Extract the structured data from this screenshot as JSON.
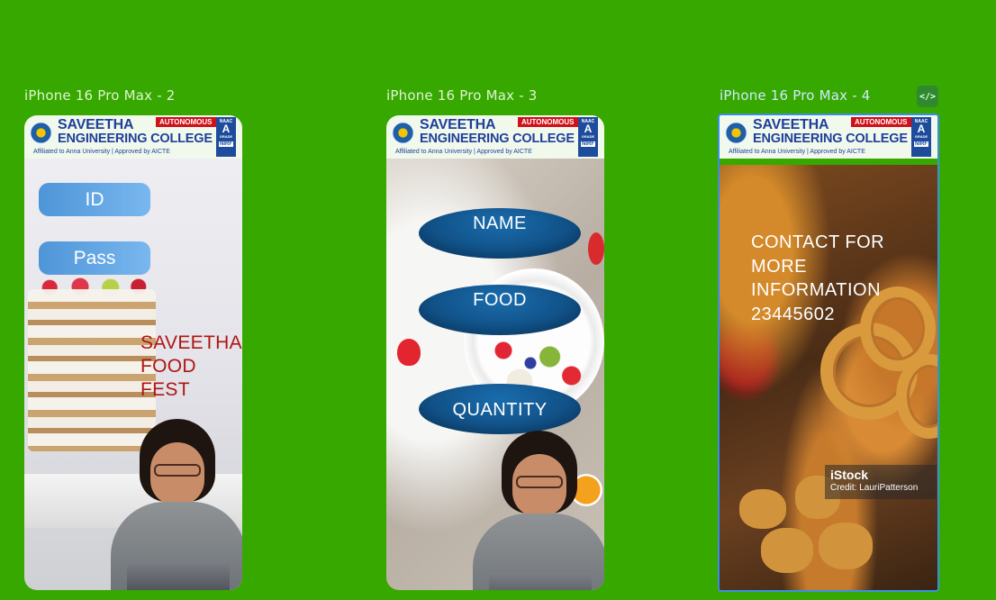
{
  "frames": [
    {
      "label": "iPhone 16 Pro Max - 2"
    },
    {
      "label": "iPhone 16 Pro Max - 3"
    },
    {
      "label": "iPhone 16 Pro Max - 4"
    }
  ],
  "code_icon": {
    "glyph": "</>",
    "icon": "code-icon"
  },
  "banner": {
    "line1": "SAVEETHA",
    "line2": "ENGINEERING COLLEGE",
    "affiliation": "Affiliated to Anna University | Approved by AICTE",
    "badge": "AUTONOMOUS",
    "naac_top": "NAAC",
    "naac_grade": "A",
    "naac_sub": "GRADE",
    "nirf": "NIRF"
  },
  "screen2": {
    "id_label": "ID",
    "pass_label": "Pass",
    "title_lines": [
      "SAVEETHA",
      "FOOD",
      "FEST"
    ]
  },
  "screen3": {
    "name_label": "NAME",
    "food_label": "FOOD",
    "quantity_label": "QUANTITY"
  },
  "screen4": {
    "contact_lines": [
      "CONTACT FOR",
      "MORE",
      "INFORMATION",
      "23445602"
    ],
    "watermark_brand": "iStock",
    "watermark_credit": "Credit: LauriPatterson"
  },
  "colors": {
    "canvas": "#37a800",
    "selection": "#3b8ee6",
    "pill": "#5fa4e4",
    "oval": "#0f4c80",
    "fest_title": "#b01414"
  }
}
